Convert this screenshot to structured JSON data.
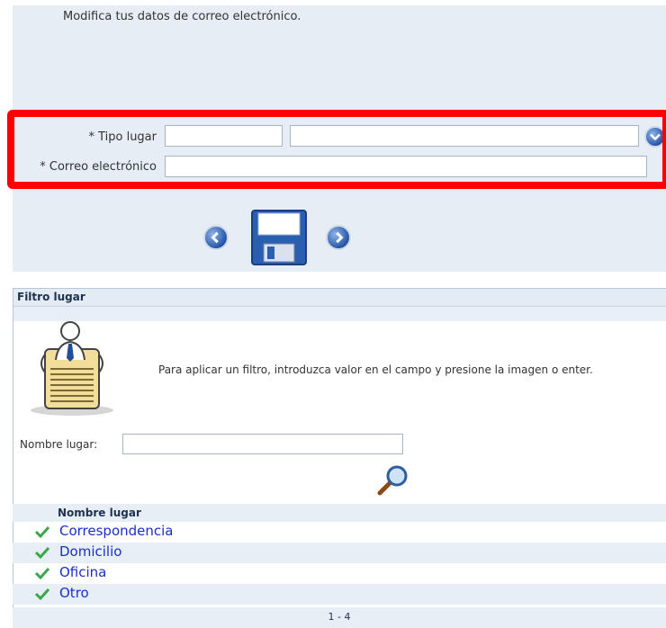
{
  "intro_text": "Modifica tus datos de correo electrónico.",
  "form": {
    "tipo_lugar_label": "* Tipo lugar",
    "tipo_lugar_code": "",
    "tipo_lugar_desc": "",
    "correo_label": "* Correo electrónico",
    "correo_value": ""
  },
  "filter": {
    "title": "Filtro lugar",
    "hint": "Para aplicar un filtro, introduzca valor en el campo y presione la imagen o enter.",
    "nombre_label": "Nombre lugar:",
    "nombre_value": ""
  },
  "results": {
    "column_header": "Nombre lugar",
    "rows": [
      "Correspondencia",
      "Domicilio",
      "Oficina",
      "Otro"
    ],
    "pager": "1 - 4"
  },
  "colors": {
    "highlight": "#ff0000",
    "link": "#1a2fc8",
    "panel": "#e7edf5"
  },
  "icons": [
    "dropdown-arrow-icon",
    "prev-arrow-icon",
    "save-floppy-icon",
    "next-arrow-icon",
    "document-person-icon",
    "search-magnifier-icon",
    "check-icon"
  ]
}
